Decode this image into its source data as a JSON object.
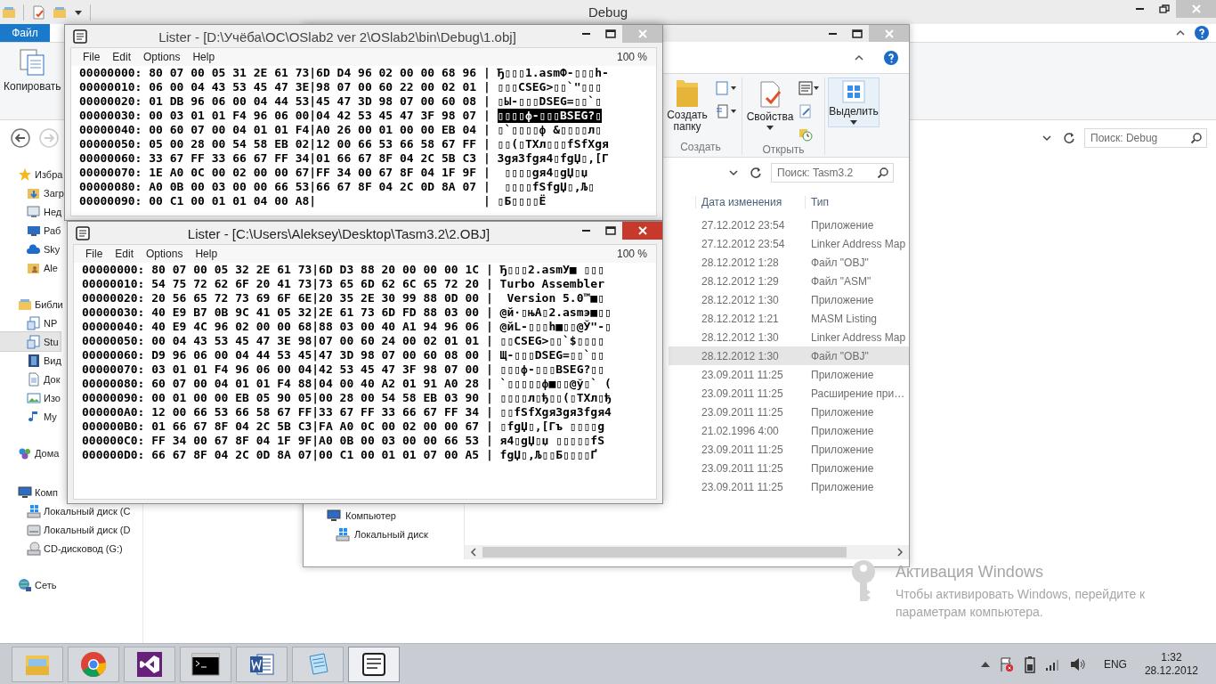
{
  "explorer_debug": {
    "title": "Debug",
    "file_tab": "Файл",
    "copy_button": "Копировать",
    "search_placeholder": "Поиск: Debug",
    "nav": [
      {
        "label": "Избра",
        "kind": "star",
        "selected": false,
        "children": [
          {
            "label": "Загр",
            "kind": "downloads",
            "selected": false
          },
          {
            "label": "Нед",
            "kind": "recent",
            "selected": false
          },
          {
            "label": "Раб",
            "kind": "desktop",
            "selected": false
          },
          {
            "label": "Sky",
            "kind": "cloud",
            "selected": false
          },
          {
            "label": "Ale",
            "kind": "user",
            "selected": false
          }
        ]
      },
      {
        "label": "Библи",
        "kind": "library",
        "selected": false,
        "children": [
          {
            "label": "NP",
            "kind": "libdoc",
            "selected": false
          },
          {
            "label": "Stu",
            "kind": "libdoc",
            "selected": true
          },
          {
            "label": "Вид",
            "kind": "video",
            "selected": false
          },
          {
            "label": "Док",
            "kind": "doc",
            "selected": false
          },
          {
            "label": "Изо",
            "kind": "image",
            "selected": false
          },
          {
            "label": "Му",
            "kind": "music",
            "selected": false
          }
        ]
      },
      {
        "label": "Дома",
        "kind": "homegroup",
        "selected": false
      },
      {
        "label": "Комп",
        "kind": "computer",
        "selected": false,
        "children": [
          {
            "label": "Локальный диск (C",
            "kind": "windisk",
            "selected": false
          },
          {
            "label": "Локальный диск (D",
            "kind": "disk",
            "selected": false
          },
          {
            "label": "CD-дисковод (G:)",
            "kind": "cd",
            "selected": false
          }
        ]
      },
      {
        "label": "Сеть",
        "kind": "network",
        "selected": false
      }
    ]
  },
  "explorer_tasm": {
    "new_folder_button": "Создать папку",
    "create_group": "Создать",
    "properties_button": "Свойства",
    "open_group": "Открыть",
    "select_button": "Выделить",
    "search_placeholder": "Поиск: Tasm3.2",
    "columns": [
      "Дата изменения",
      "Тип"
    ],
    "files": [
      {
        "date": "27.12.2012 23:54",
        "type": "Приложение",
        "selected": false
      },
      {
        "date": "27.12.2012 23:54",
        "type": "Linker Address Map",
        "selected": false
      },
      {
        "date": "28.12.2012 1:28",
        "type": "Файл \"OBJ\"",
        "selected": false
      },
      {
        "date": "28.12.2012 1:29",
        "type": "Файл \"ASM\"",
        "selected": false
      },
      {
        "date": "28.12.2012 1:30",
        "type": "Приложение",
        "selected": false
      },
      {
        "date": "28.12.2012 1:21",
        "type": "MASM Listing",
        "selected": false
      },
      {
        "date": "28.12.2012 1:30",
        "type": "Linker Address Map",
        "selected": false
      },
      {
        "date": "28.12.2012 1:30",
        "type": "Файл \"OBJ\"",
        "selected": true
      },
      {
        "date": "23.09.2011 11:25",
        "type": "Приложение",
        "selected": false
      },
      {
        "date": "23.09.2011 11:25",
        "type": "Расширение при…",
        "selected": false
      },
      {
        "date": "23.09.2011 11:25",
        "type": "Приложение",
        "selected": false
      },
      {
        "date": "21.02.1996 4:00",
        "type": "Приложение",
        "selected": false
      },
      {
        "date": "23.09.2011 11:25",
        "type": "Приложение",
        "selected": false
      },
      {
        "date": "23.09.2011 11:25",
        "type": "Приложение",
        "selected": false
      },
      {
        "date": "23.09.2011 11:25",
        "type": "Приложение",
        "selected": false
      }
    ],
    "nav": [
      {
        "label": "Компьютер",
        "kind": "computer"
      },
      {
        "label": "Локальный диск",
        "kind": "windisk"
      }
    ]
  },
  "listers": [
    {
      "title": "Lister - [D:\\Учёба\\ОС\\OSlab2 ver 2\\OSlab2\\bin\\Debug\\1.obj]",
      "active": false,
      "menu": [
        "File",
        "Edit",
        "Options",
        "Help"
      ],
      "zoom": "100 %",
      "rows": [
        {
          "hex": "00000000: 80 07 00 05 31 2E 61 73|6D D4 96 02 00 00 68 96 |",
          "ascii": "Ђ▯▯▯1.asmФ-▯▯▯h-",
          "selected": false
        },
        {
          "hex": "00000010: 06 00 04 43 53 45 47 3E|98 07 00 60 22 00 02 01 |",
          "ascii": "▯▯▯CSEG>▯▯`\"▯▯▯",
          "selected": false
        },
        {
          "hex": "00000020: 01 DB 96 06 00 04 44 53|45 47 3D 98 07 00 60 08 |",
          "ascii": "▯Ы-▯▯▯DSEG=▯▯`▯",
          "selected": false
        },
        {
          "hex": "00000030: 00 03 01 01 F4 96 06 00|04 42 53 45 47 3F 98 07 |",
          "ascii": "▯▯▯▯ф-▯▯▯BSEG?▯",
          "selected": true
        },
        {
          "hex": "00000040: 00 60 07 00 04 01 01 F4|A0 26 00 01 00 00 EB 04 |",
          "ascii": "▯`▯▯▯▯ф &▯▯▯▯л▯",
          "selected": false
        },
        {
          "hex": "00000050: 05 00 28 00 54 58 EB 02|12 00 66 53 66 58 67 FF |",
          "ascii": "▯▯(▯TXл▯▯▯fSfXgя",
          "selected": false
        },
        {
          "hex": "00000060: 33 67 FF 33 66 67 FF 34|01 66 67 8F 04 2C 5B C3 |",
          "ascii": "3gя3fgя4▯fgЏ▯,[Г",
          "selected": false
        },
        {
          "hex": "00000070: 1E A0 0C 00 02 00 00 67|FF 34 00 67 8F 04 1F 9F |",
          "ascii": " ▯▯▯▯gя4▯gЏ▯џ",
          "selected": false
        },
        {
          "hex": "00000080: A0 0B 00 03 00 00 66 53|66 67 8F 04 2C 0D 8A 07 |",
          "ascii": " ▯▯▯▯fSfgЏ▯,Љ▯",
          "selected": false
        },
        {
          "hex": "00000090: 00 C1 00 01 01 04 00 A8|                        |",
          "ascii": "▯Б▯▯▯▯Ё",
          "selected": false
        }
      ]
    },
    {
      "title": "Lister - [C:\\Users\\Aleksey\\Desktop\\Tasm3.2\\2.OBJ]",
      "active": true,
      "menu": [
        "File",
        "Edit",
        "Options",
        "Help"
      ],
      "zoom": "100 %",
      "rows": [
        {
          "hex": "00000000: 80 07 00 05 32 2E 61 73|6D D3 88 20 00 00 00 1C |",
          "ascii": "Ђ▯▯▯2.asmУ■ ▯▯▯",
          "selected": false
        },
        {
          "hex": "00000010: 54 75 72 62 6F 20 41 73|73 65 6D 62 6C 65 72 20 |",
          "ascii": "Turbo Assembler",
          "selected": false
        },
        {
          "hex": "00000020: 20 56 65 72 73 69 6F 6E|20 35 2E 30 99 88 0D 00 |",
          "ascii": " Version 5.0™■▯",
          "selected": false
        },
        {
          "hex": "00000030: 40 E9 B7 0B 9C 41 05 32|2E 61 73 6D FD 88 03 00 |",
          "ascii": "@й·▯њA▯2.asmэ■▯▯",
          "selected": false
        },
        {
          "hex": "00000040: 40 E9 4C 96 02 00 00 68|88 03 00 40 A1 94 96 06 |",
          "ascii": "@йL-▯▯▯h■▯▯@Ў\"-▯",
          "selected": false
        },
        {
          "hex": "00000050: 00 04 43 53 45 47 3E 98|07 00 60 24 00 02 01 01 |",
          "ascii": "▯▯CSEG>▯▯`$▯▯▯▯",
          "selected": false
        },
        {
          "hex": "00000060: D9 96 06 00 04 44 53 45|47 3D 98 07 00 60 08 00 |",
          "ascii": "Щ-▯▯▯DSEG=▯▯`▯▯",
          "selected": false
        },
        {
          "hex": "00000070: 03 01 01 F4 96 06 00 04|42 53 45 47 3F 98 07 00 |",
          "ascii": "▯▯▯ф-▯▯▯BSEG?▯▯",
          "selected": false
        },
        {
          "hex": "00000080: 60 07 00 04 01 01 F4 88|04 00 40 A2 01 91 A0 28 |",
          "ascii": "`▯▯▯▯▯ф■▯▯@ў▯` (",
          "selected": false
        },
        {
          "hex": "00000090: 00 01 00 00 EB 05 90 05|00 28 00 54 58 EB 03 90 |",
          "ascii": "▯▯▯▯л▯ђ▯▯(▯TXл▯ђ",
          "selected": false
        },
        {
          "hex": "000000A0: 12 00 66 53 66 58 67 FF|33 67 FF 33 66 67 FF 34 |",
          "ascii": "▯▯fSfXgя3gя3fgя4",
          "selected": false
        },
        {
          "hex": "000000B0: 01 66 67 8F 04 2C 5B C3|FA A0 0C 00 02 00 00 67 |",
          "ascii": "▯fgЏ▯,[Гъ ▯▯▯▯g",
          "selected": false
        },
        {
          "hex": "000000C0: FF 34 00 67 8F 04 1F 9F|A0 0B 00 03 00 00 66 53 |",
          "ascii": "я4▯gЏ▯џ ▯▯▯▯▯fS",
          "selected": false
        },
        {
          "hex": "000000D0: 66 67 8F 04 2C 0D 8A 07|00 C1 00 01 01 07 00 A5 |",
          "ascii": "fgЏ▯,Љ▯▯Б▯▯▯▯Ґ",
          "selected": false
        }
      ]
    }
  ],
  "activation": {
    "title": "Активация Windows",
    "text": "Чтобы активировать Windows, перейдите к параметрам компьютера."
  },
  "taskbar": {
    "apps": [
      {
        "kind": "explorer",
        "selected": false
      },
      {
        "kind": "browser",
        "selected": false
      },
      {
        "kind": "studio",
        "selected": false
      },
      {
        "kind": "terminal",
        "selected": false
      },
      {
        "kind": "word",
        "selected": false
      },
      {
        "kind": "notepad",
        "selected": false
      },
      {
        "kind": "lister",
        "selected": true
      }
    ],
    "language": "ENG",
    "time": "1:32",
    "date": "28.12.2012"
  }
}
